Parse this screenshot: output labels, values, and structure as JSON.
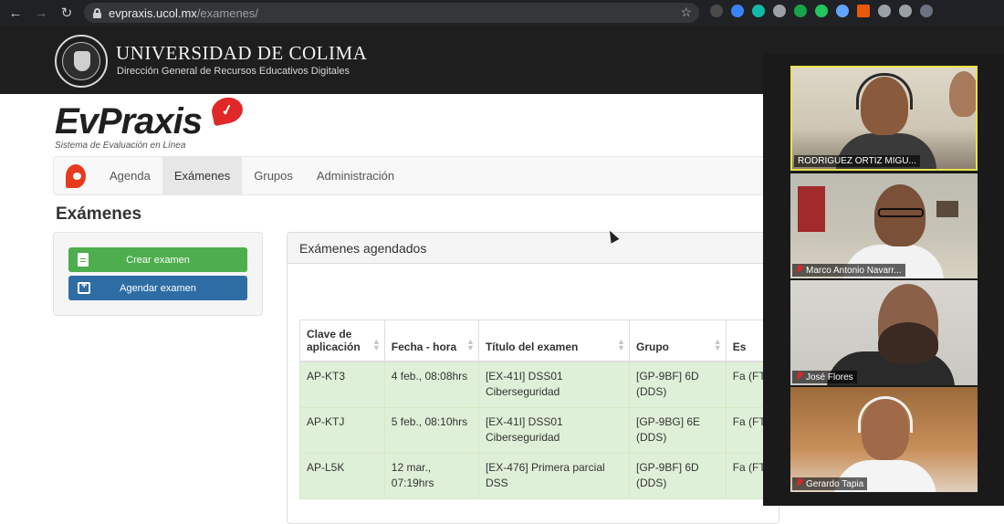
{
  "browser": {
    "url_host": "evpraxis.ucol.mx",
    "url_path": "/examenes/",
    "extension_colors": [
      "#4a4a4a",
      "#3b82f6",
      "#14b8a6",
      "#9aa0a6",
      "#16a34a",
      "#22c55e",
      "#60a5fa",
      "#ea580c",
      "#9aa0a6",
      "#9aa0a6",
      "#6b7280"
    ]
  },
  "institution": {
    "name": "UNIVERSIDAD DE COLIMA",
    "subtitle": "Dirección General de Recursos Educativos Digitales"
  },
  "app": {
    "name": "EvPraxis",
    "tagline": "Sistema de Evaluación en Línea"
  },
  "nav": {
    "items": [
      {
        "label": "Agenda",
        "active": false
      },
      {
        "label": "Exámenes",
        "active": true
      },
      {
        "label": "Grupos",
        "active": false
      },
      {
        "label": "Administración",
        "active": false
      }
    ]
  },
  "page": {
    "title": "Exámenes"
  },
  "actions": {
    "create_label": "Crear examen",
    "schedule_label": "Agendar examen"
  },
  "scheduled": {
    "heading": "Exámenes agendados",
    "columns": [
      "Clave de aplicación",
      "Fecha - hora",
      "Título del examen",
      "Grupo",
      "Es"
    ],
    "rows": [
      {
        "clave": "AP-KT3",
        "fecha": "4 feb., 08:08hrs",
        "titulo": "[EX-41I] DSS01 Ciberseguridad",
        "grupo": "[GP-9BF] 6D (DDS)",
        "estado": "Fa (FT"
      },
      {
        "clave": "AP-KTJ",
        "fecha": "5 feb., 08:10hrs",
        "titulo": "[EX-41I] DSS01 Ciberseguridad",
        "grupo": "[GP-9BG] 6E (DDS)",
        "estado": "Fa (FT"
      },
      {
        "clave": "AP-L5K",
        "fecha": "12 mar., 07:19hrs",
        "titulo": "[EX-476] Primera parcial DSS",
        "grupo": "[GP-9BF] 6D (DDS)",
        "estado": "Fa (FT"
      }
    ]
  },
  "meeting": {
    "participants": [
      {
        "name": "RODRIGUEZ ORTIZ MIGU...",
        "muted": false,
        "speaking": true
      },
      {
        "name": "Marco Antonio Navarr...",
        "muted": true,
        "speaking": false
      },
      {
        "name": "José Flores",
        "muted": true,
        "speaking": false
      },
      {
        "name": "Gerardo Tapia",
        "muted": true,
        "speaking": false
      }
    ]
  }
}
